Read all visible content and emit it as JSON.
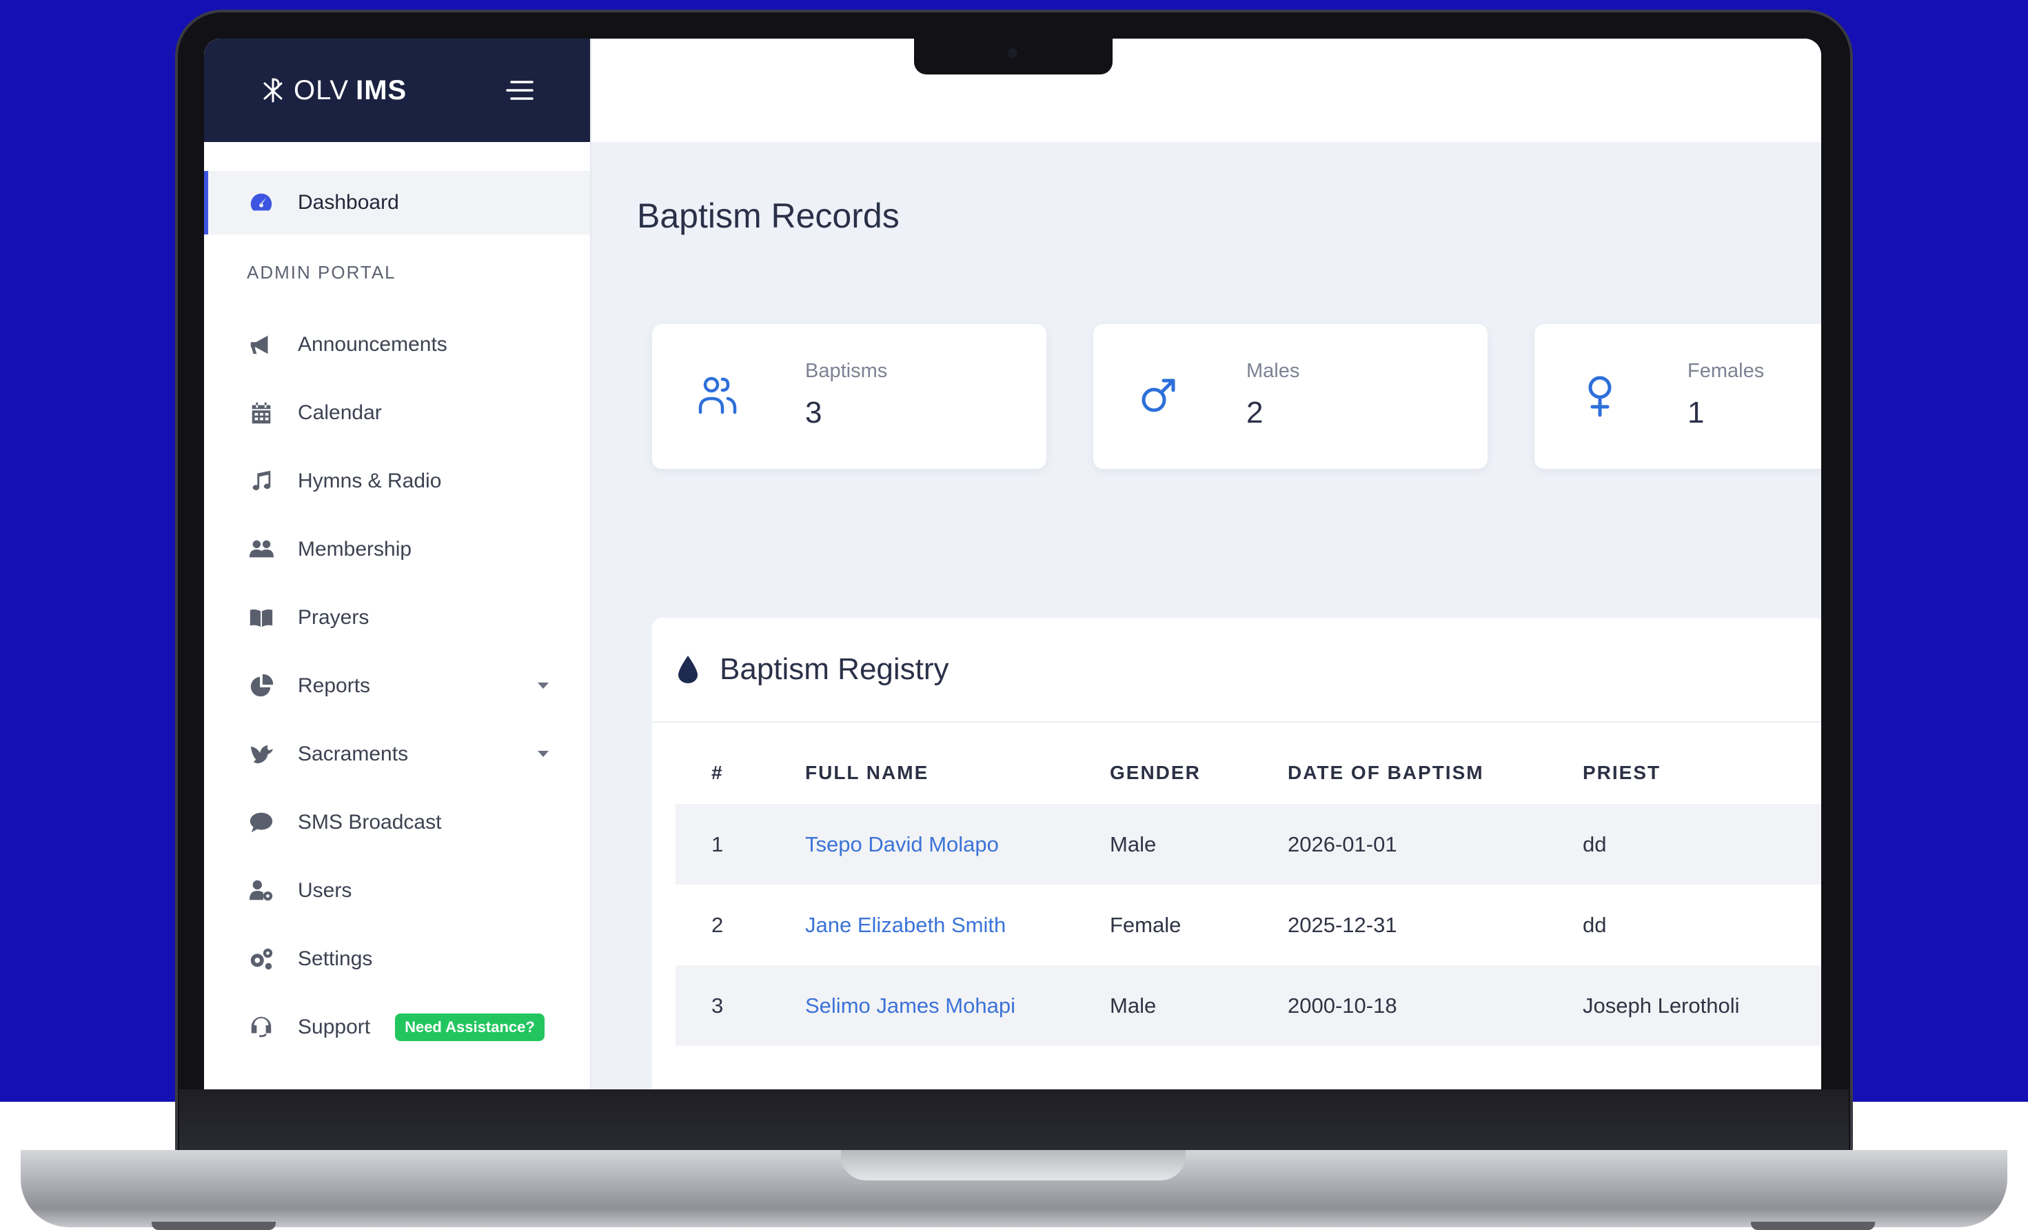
{
  "brand": {
    "name_light": "OLV",
    "name_bold": "IMS"
  },
  "sidebar": {
    "dashboard_label": "Dashboard",
    "section_heading": "ADMIN PORTAL",
    "items": [
      {
        "label": "Announcements",
        "icon": "megaphone-icon"
      },
      {
        "label": "Calendar",
        "icon": "calendar-icon"
      },
      {
        "label": "Hymns & Radio",
        "icon": "music-note-icon"
      },
      {
        "label": "Membership",
        "icon": "users-icon"
      },
      {
        "label": "Prayers",
        "icon": "book-icon"
      },
      {
        "label": "Reports",
        "icon": "pie-chart-icon",
        "has_submenu": true
      },
      {
        "label": "Sacraments",
        "icon": "dove-icon",
        "has_submenu": true
      },
      {
        "label": "SMS Broadcast",
        "icon": "chat-bubble-icon"
      },
      {
        "label": "Users",
        "icon": "user-gear-icon"
      },
      {
        "label": "Settings",
        "icon": "gears-icon"
      },
      {
        "label": "Support",
        "icon": "headset-icon",
        "badge": "Need Assistance?"
      }
    ]
  },
  "page": {
    "title": "Baptism Records"
  },
  "stats": [
    {
      "label": "Baptisms",
      "value": "3",
      "icon": "people-icon"
    },
    {
      "label": "Males",
      "value": "2",
      "icon": "male-symbol-icon"
    },
    {
      "label": "Females",
      "value": "1",
      "icon": "female-symbol-icon"
    }
  ],
  "registry": {
    "title": "Baptism Registry",
    "columns": [
      "#",
      "FULL NAME",
      "GENDER",
      "DATE OF BAPTISM",
      "PRIEST"
    ],
    "rows": [
      {
        "num": "1",
        "name": "Tsepo David Molapo",
        "gender": "Male",
        "date": "2026-01-01",
        "priest": "dd"
      },
      {
        "num": "2",
        "name": "Jane Elizabeth Smith",
        "gender": "Female",
        "date": "2025-12-31",
        "priest": "dd"
      },
      {
        "num": "3",
        "name": "Selimo James Mohapi",
        "gender": "Male",
        "date": "2000-10-18",
        "priest": "Joseph Lerotholi"
      }
    ]
  },
  "colors": {
    "background": "#1410b4",
    "brand_bar": "#1b2241",
    "accent": "#3d55e0",
    "link": "#3b73d8",
    "icon_blue": "#2d6fd9",
    "badge_green": "#22c55e"
  }
}
